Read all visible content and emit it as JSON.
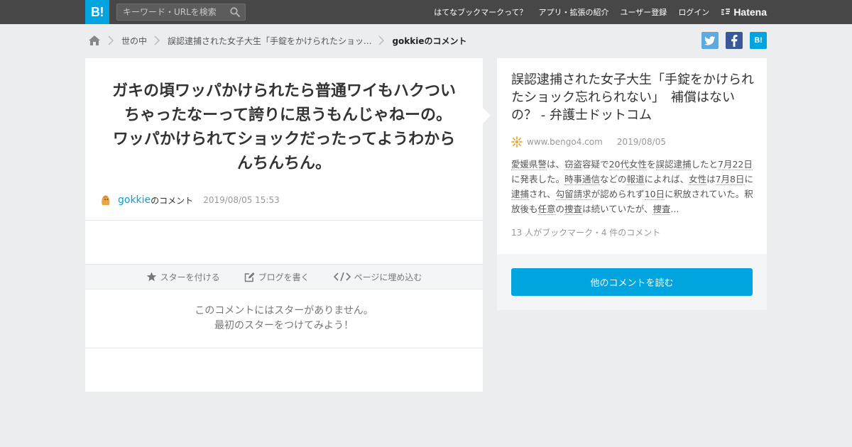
{
  "header": {
    "logo_label": "B!",
    "search": {
      "placeholder": "キーワード・URLを検索",
      "value": ""
    },
    "nav": [
      {
        "label": "はてなブックマークって？"
      },
      {
        "label": "アプリ・拡張の紹介"
      },
      {
        "label": "ユーザー登録"
      },
      {
        "label": "ログイン"
      }
    ],
    "brand": "Hatena"
  },
  "breadcrumb": {
    "items": [
      {
        "label": "世の中"
      },
      {
        "label": "誤認逮捕された女子大生「手錠をかけられたショッ..."
      }
    ],
    "current": "gokkieのコメント"
  },
  "share": {
    "hatena_label": "B!"
  },
  "comment": {
    "text": "ガキの頃ワッパかけられたら普通ワイもハクついちゃったなーって誇りに思うもんじゃねーの。　ワッパかけられてショックだったってようわからんちんちん。",
    "user": "gokkie",
    "user_suffix": "のコメント",
    "timestamp": "2019/08/05 15:53",
    "actions": [
      {
        "label": "スターを付ける"
      },
      {
        "label": "ブログを書く"
      },
      {
        "label": "ページに埋め込む"
      }
    ],
    "no_star_line1": "このコメントにはスターがありません。",
    "no_star_line2": "最初のスターをつけてみよう！"
  },
  "entry": {
    "title": "誤認逮捕された女子大生「手錠をかけられたショック忘れられない」　補償はないの？ - 弁護士ドットコム",
    "domain": "www.bengo4.com",
    "date": "2019/08/05",
    "excerpt": [
      {
        "t": "愛媛県警",
        "kw": true
      },
      {
        "t": "は、",
        "kw": false
      },
      {
        "t": "窃盗",
        "kw": true
      },
      {
        "t": "容疑で",
        "kw": false
      },
      {
        "t": "20代",
        "kw": true
      },
      {
        "t": "女性",
        "kw": true
      },
      {
        "t": "を",
        "kw": false
      },
      {
        "t": "誤認逮捕",
        "kw": true
      },
      {
        "t": "したと",
        "kw": false
      },
      {
        "t": "7月22日",
        "kw": true
      },
      {
        "t": "に発表した。",
        "kw": false
      },
      {
        "t": "時事通信",
        "kw": true
      },
      {
        "t": "などの",
        "kw": false
      },
      {
        "t": "報道",
        "kw": true
      },
      {
        "t": "によれば、",
        "kw": false
      },
      {
        "t": "女性",
        "kw": true
      },
      {
        "t": "は",
        "kw": false
      },
      {
        "t": "7月8日",
        "kw": true
      },
      {
        "t": "に",
        "kw": false
      },
      {
        "t": "逮捕",
        "kw": true
      },
      {
        "t": "され、",
        "kw": false
      },
      {
        "t": "勾留請求",
        "kw": true
      },
      {
        "t": "が認められず",
        "kw": false
      },
      {
        "t": "10日",
        "kw": true
      },
      {
        "t": "に釈放されていた。釈放後も",
        "kw": false
      },
      {
        "t": "任意",
        "kw": true
      },
      {
        "t": "の",
        "kw": false
      },
      {
        "t": "捜査",
        "kw": true
      },
      {
        "t": "は続いていたが、",
        "kw": false
      },
      {
        "t": "捜査",
        "kw": true
      },
      {
        "t": "...",
        "kw": false
      }
    ],
    "stats": "13 人がブックマーク・4 件のコメント",
    "read_more": "他のコメントを読む"
  },
  "colors": {
    "hatena_blue": "#00a4de",
    "topbar": "#474747",
    "background": "#ebedef",
    "twitter": "#5ea9dd",
    "facebook": "#3a5897"
  }
}
